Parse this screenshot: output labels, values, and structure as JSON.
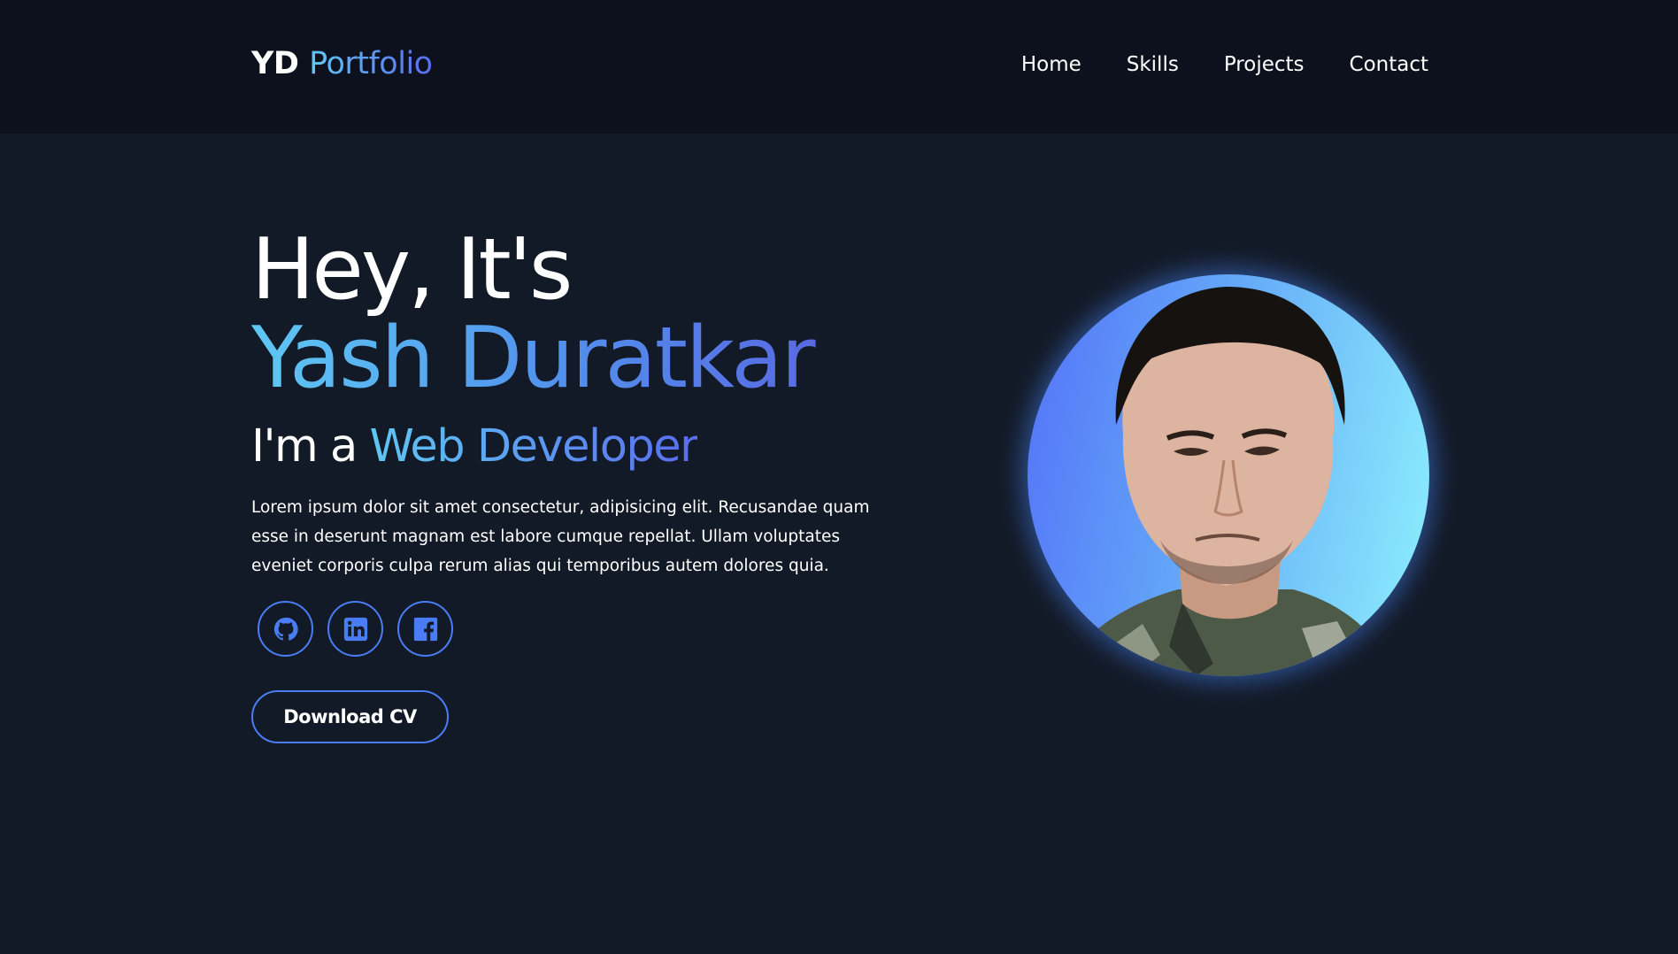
{
  "logo": {
    "prefix": "YD",
    "suffix": "Portfolio"
  },
  "nav": {
    "items": [
      {
        "label": "Home"
      },
      {
        "label": "Skills"
      },
      {
        "label": "Projects"
      },
      {
        "label": "Contact"
      }
    ]
  },
  "hero": {
    "greeting": "Hey, It's",
    "name": "Yash Duratkar",
    "role_prefix": "I'm a",
    "role": "Web Developer",
    "bio": "Lorem ipsum dolor sit amet consectetur, adipisicing elit. Recusandae quam esse in deserunt magnam est labore cumque repellat. Ullam voluptates eveniet corporis culpa rerum alias qui temporibus autem dolores quia.",
    "cta_label": "Download CV"
  },
  "socials": [
    {
      "icon": "github-icon"
    },
    {
      "icon": "linkedin-icon"
    },
    {
      "icon": "facebook-icon"
    }
  ],
  "colors": {
    "background": "#131a27",
    "navbar": "#0d111d",
    "accent_blue": "#4a7df5",
    "gradient_start": "#5ec8f2",
    "gradient_end": "#5a5fde"
  }
}
